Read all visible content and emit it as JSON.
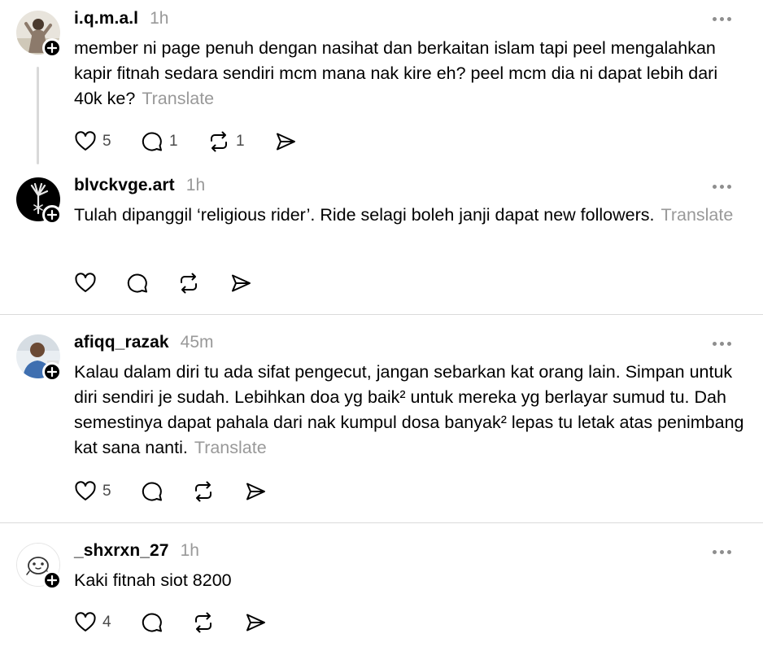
{
  "posts": [
    {
      "username": "i.q.m.a.l",
      "time": "1h",
      "text": "member ni page penuh dengan nasihat dan berkaitan islam tapi peel mengalahkan kapir fitnah sedara sendiri mcm mana nak kire eh? peel mcm dia ni dapat lebih dari 40k ke?",
      "translate": "Translate",
      "likes": "5",
      "replies": "1",
      "reposts": "1"
    },
    {
      "username": "blvckvge.art",
      "time": "1h",
      "text": "Tulah dipanggil ‘religious rider’. Ride selagi boleh janji dapat new followers.",
      "translate": "Translate"
    },
    {
      "username": "afiqq_razak",
      "time": "45m",
      "text": "Kalau dalam diri tu ada sifat pengecut, jangan sebarkan kat orang lain. Simpan untuk diri sendiri je sudah. Lebihkan doa yg baik² untuk mereka yg berlayar sumud tu. Dah semestinya dapat pahala dari nak kumpul dosa banyak² lepas tu letak atas penimbang kat sana nanti.",
      "translate": "Translate",
      "likes": "5"
    },
    {
      "username": "_shxrxn_27",
      "time": "1h",
      "text": "Kaki fitnah siot 8200",
      "likes": "4"
    }
  ],
  "icons": {
    "like": "heart-icon",
    "reply": "comment-icon",
    "repost": "repost-icon",
    "share": "send-icon",
    "more": "more-options-icon",
    "follow": "plus-icon"
  },
  "colors": {
    "text": "#000000",
    "muted": "#999999",
    "divider": "#dbdbdb",
    "thread_line": "#d9d9d9"
  }
}
